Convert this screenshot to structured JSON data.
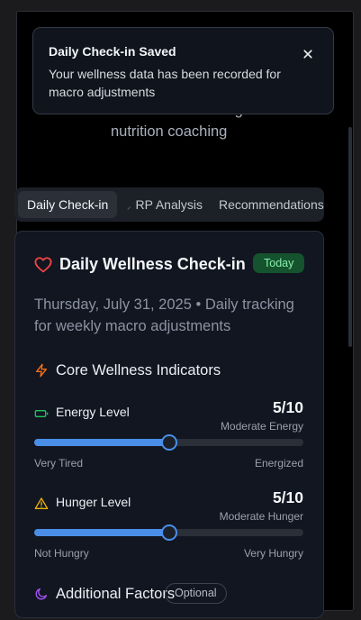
{
  "toast": {
    "title": "Daily Check-in Saved",
    "message": "Your wellness data has been recorded for macro adjustments",
    "close_icon": "close-icon"
  },
  "header": {
    "subtitle": "Periodization intelligent nutrition coaching"
  },
  "tabs": [
    {
      "label": "Daily Check-in",
      "active": true
    },
    {
      "label": "RP Analysis",
      "icon": "chart-icon",
      "active": false
    },
    {
      "label": "Recommendations",
      "active": false
    }
  ],
  "card": {
    "title": "Daily Wellness Check-in",
    "title_icon": "heart-icon",
    "badge": "Today",
    "subtitle": "Thursday, July 31, 2025 • Daily tracking for weekly macro adjustments",
    "core_section": {
      "title": "Core Wellness Indicators",
      "icon": "zap-icon"
    },
    "metrics": [
      {
        "label": "Energy Level",
        "icon": "battery-icon",
        "value": "5/10",
        "level": 5,
        "max": 10,
        "description": "Moderate Energy",
        "min_label": "Very Tired",
        "max_label": "Energized"
      },
      {
        "label": "Hunger Level",
        "icon": "warning-icon",
        "value": "5/10",
        "level": 5,
        "max": 10,
        "description": "Moderate Hunger",
        "min_label": "Not Hungry",
        "max_label": "Very Hungry"
      }
    ],
    "additional_section": {
      "title": "Additional Factors",
      "icon": "moon-icon",
      "pill": "Optional"
    }
  },
  "colors": {
    "accent": "#4a8ee8",
    "heart": "#ef4444",
    "zap": "#f97316",
    "battery": "#22c55e",
    "warning": "#eab308",
    "moon": "#a855f7",
    "badge_bg": "#14532d",
    "badge_text": "#86efac"
  }
}
